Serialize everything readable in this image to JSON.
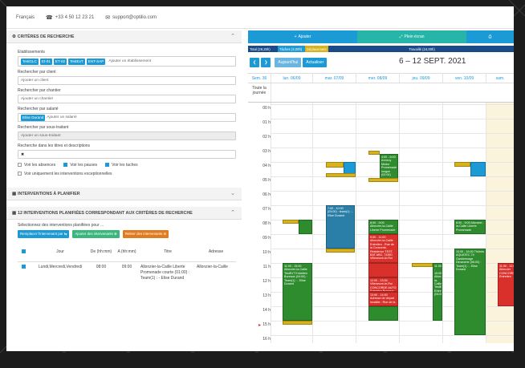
{
  "topbar": {
    "language": "Français",
    "phone": "+33 4 50 12 23 21",
    "email": "support@optilio.com"
  },
  "criteria": {
    "title": "CRITÈRES DE RECHERCHE",
    "etab_label": "Etablissements",
    "etab_tags": [
      "TestGLC",
      "Et-01",
      "ET-02",
      "TestExT",
      "ENT-SAP"
    ],
    "etab_placeholder": "Ajouter un établissement",
    "client_label": "Rechercher par client",
    "client_placeholder": "Ajouter un client",
    "chantier_label": "Rechercher par chantier",
    "chantier_placeholder": "Ajouter un chantier",
    "salarie_label": "Rechercher par salarié",
    "salarie_tag": "Elise Durand",
    "salarie_placeholder": "Ajouter un salarié",
    "soustraitant_label": "Rechercher par sous-traitant",
    "soustraitant_placeholder": "Ajouter un sous-traitant",
    "titres_label": "Recherche dans les titres et descriptions",
    "titres_value": "✖",
    "check_absences": "Voir les absences",
    "check_pauses": "Voir les pauses",
    "check_taches": "Voir les taches",
    "check_exceptionnelles": "Voir uniquement les interventions exceptionnelles"
  },
  "planifier": {
    "title": "INTERVENTIONS À PLANIFIER"
  },
  "planned": {
    "title": "12 INTERVENTIONS PLANIFIÉES CORRESPONDANT AUX CRITÈRES DE RECHERCHE",
    "subtitle": "Sélectionnez des interventions planifiées pour ...",
    "btn_replace": "Remplacer l'intervenant par ⇆",
    "btn_add": "Ajouter des intervenants ⊕",
    "btn_remove": "Retirer des intervenants ⊖",
    "headers": [
      "",
      "Jour",
      "De (hh:mm)",
      "A (hh:mm)",
      "Titre",
      "Adresse"
    ],
    "rows": [
      {
        "jour": "Lundi,Mercredi,Vendredi",
        "de": "08:00",
        "a": "09:00",
        "titre": "Allonzier-la-Caille Liberte Promenade courte (01:00) : Team(1) : - Elise Durand",
        "adresse": "Allonzier-la-Caille"
      }
    ]
  },
  "calendar": {
    "btn_add": "Ajouter",
    "btn_fullscreen": "Plein écran",
    "legend": [
      "Total (29,28h)",
      "Tâches (3,00h)",
      "Déplacement",
      "Travaillé (24,00h)"
    ],
    "today": "Aujourd'hui",
    "refresh": "Actualiser",
    "range": "6 – 12 SEPT. 2021",
    "days": [
      "Sem. 36",
      "lun. 06/09",
      "mar. 07/09",
      "mer. 08/09",
      "jeu. 09/09",
      "ven. 10/09",
      "sam."
    ],
    "allday": "Toute la journée",
    "hours": [
      "00 h",
      "01 h",
      "02 h",
      "03 h",
      "04 h",
      "05 h",
      "06 h",
      "07 h",
      "08 h",
      "09 h",
      "10 h",
      "11 h",
      "12 h",
      "13 h",
      "14 h",
      "15 h",
      "16 h"
    ],
    "events": {
      "mar_7": "7:00 - 10:00 (03:00) : team(1) : - Elise Durand",
      "mer_4": "4:00 - 6:00 Annecy Medor Promenade longue (02:00)",
      "mer_8": "8:00 - 9:00 Allonzier-la-Caille Liberte Promenade",
      "mer_9": "9:00 - 11:00 Allonzier-la-Caille Entretien - Rue de la Concorde, Résidence TEST, BAT ABC, 74350 Villeneuve-le-Roi",
      "mer_12": "12:00 - 13:00 Villeneuve-le-Roi CONCORDE AUTO Entretien Bureaux",
      "mer_13": "13:00 - 14:00 Adresse de départ invalide : Rue de la",
      "lun_11": "11:00 - 15:00 Allonzier-la-Caille TestExT Entretien Bureaux (04:00) : Team(1) : - Elise Durand",
      "jeu_11": "11:00 - 15:00 Allonzier-la-Caille TestExT Entretien (04:00)",
      "ven_8": "8:00 - 9:00 Allonzier-la-Caille Liberte Promenade",
      "ven_10": "10:00 - 16:00 Thônes AQUATEC 74 Gardiennage Dimanche (06:00) : Team(1) : - Elise Durand",
      "sam_11": "11:00 - 12:00 Allonzier CONCORDE Entretien"
    }
  },
  "colors": {
    "blue": "#1c9ad6",
    "teal": "#26b5a8",
    "green": "#2e8b2e",
    "red": "#d9302b",
    "yellow": "#d8b21a",
    "navy": "#1a4a8a",
    "orange": "#e07b20"
  }
}
